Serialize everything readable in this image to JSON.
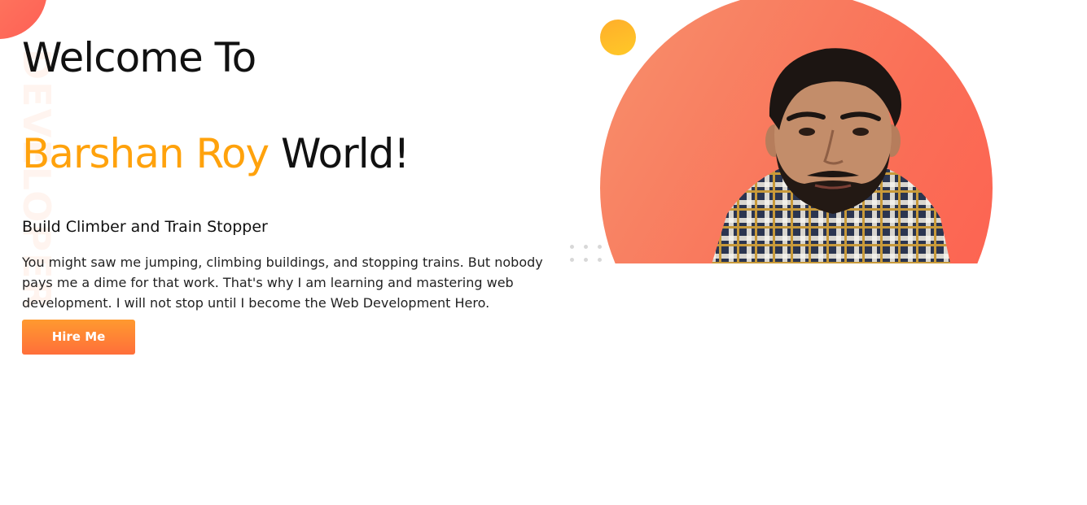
{
  "hero": {
    "background_word": "DEVELOPER",
    "headline_line1": "Welcome To",
    "headline_name": "Barshan Roy",
    "headline_suffix": "World!",
    "subtitle": "Build Climber and Train Stopper",
    "description": "You might saw me jumping, climbing buildings, and stopping trains. But nobody pays me a dime for that work. That's why I am learning and mastering web development. I will not stop until I become the Web Development Hero.",
    "cta_label": "Hire Me"
  },
  "colors": {
    "accent_name": "#ffa20c",
    "button_gradient_top": "#ff9a2f",
    "button_gradient_bottom": "#ff6f3a",
    "circle_primary": "#fa6f57",
    "small_circle": "#ffb72a"
  },
  "icons": {
    "portrait": "person-portrait"
  }
}
